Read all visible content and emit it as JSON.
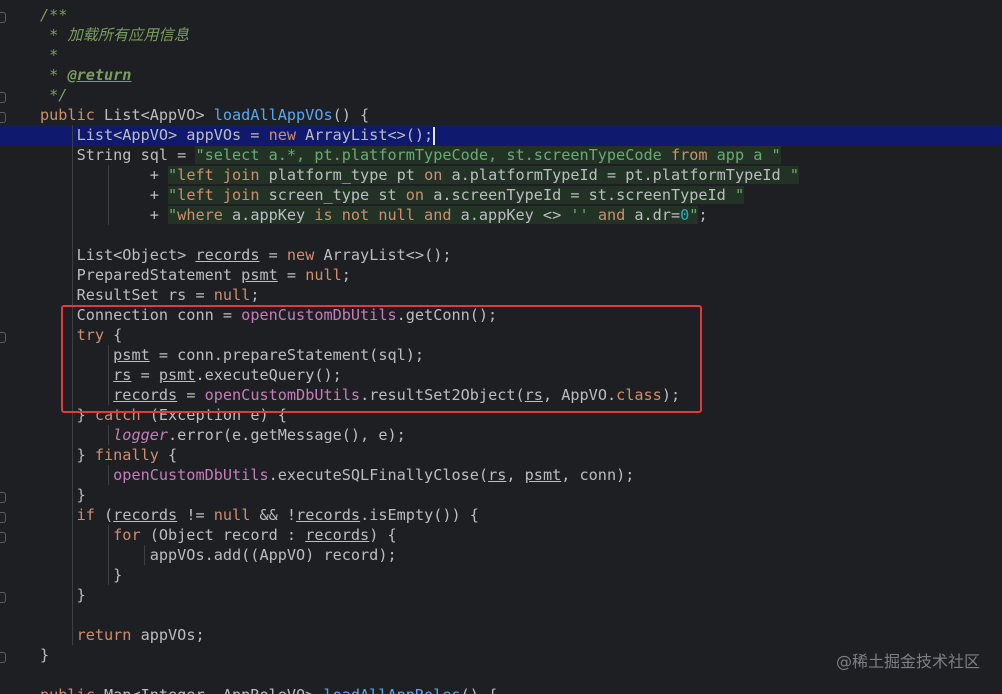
{
  "code_lines": [
    {
      "tokens": [
        {
          "t": "/**",
          "c": "cm"
        }
      ]
    },
    {
      "tokens": [
        {
          "t": " * 加载所有应用信息",
          "c": "cm"
        }
      ]
    },
    {
      "tokens": [
        {
          "t": " *",
          "c": "cm"
        }
      ]
    },
    {
      "tokens": [
        {
          "t": " * ",
          "c": "cm"
        },
        {
          "t": "@return",
          "c": "tag"
        }
      ]
    },
    {
      "tokens": [
        {
          "t": " */",
          "c": "cm"
        }
      ]
    },
    {
      "tokens": [
        {
          "t": "public ",
          "c": "kw"
        },
        {
          "t": "List<AppVO> ",
          "c": "plain"
        },
        {
          "t": "loadAllAppVOs",
          "c": "fn"
        },
        {
          "t": "() {",
          "c": "plain"
        }
      ]
    },
    {
      "current": true,
      "tokens": [
        {
          "t": "    List<AppVO> appVOs = ",
          "c": "plain"
        },
        {
          "t": "new ",
          "c": "kw"
        },
        {
          "t": "ArrayList<>();",
          "c": "plain"
        }
      ]
    },
    {
      "tokens": [
        {
          "t": "    String sql = ",
          "c": "plain"
        },
        {
          "t": "\"select a.*, pt.platformTypeCode, st.screenTypeCode ",
          "c": "str-bg"
        },
        {
          "t": "from",
          "c": "kw-bg"
        },
        {
          "t": " app a \"",
          "c": "str-bg"
        }
      ]
    },
    {
      "tokens": [
        {
          "t": "            + ",
          "c": "plain"
        },
        {
          "t": "\"",
          "c": "str-bg"
        },
        {
          "t": "left join",
          "c": "kw-bg"
        },
        {
          "t": " platform_type pt ",
          "c": "plain-bg"
        },
        {
          "t": "on",
          "c": "kw-bg"
        },
        {
          "t": " a.platformTypeId = pt.platformTypeId ",
          "c": "plain-bg"
        },
        {
          "t": "\"",
          "c": "str-bg"
        }
      ]
    },
    {
      "tokens": [
        {
          "t": "            + ",
          "c": "plain"
        },
        {
          "t": "\"",
          "c": "str-bg"
        },
        {
          "t": "left join",
          "c": "kw-bg"
        },
        {
          "t": " screen_type st ",
          "c": "plain-bg"
        },
        {
          "t": "on",
          "c": "kw-bg"
        },
        {
          "t": " a.screenTypeId = st.screenTypeId ",
          "c": "plain-bg"
        },
        {
          "t": "\"",
          "c": "str-bg"
        }
      ]
    },
    {
      "tokens": [
        {
          "t": "            + ",
          "c": "plain"
        },
        {
          "t": "\"",
          "c": "str-bg"
        },
        {
          "t": "where",
          "c": "kw-bg"
        },
        {
          "t": " a.appKey ",
          "c": "plain-bg"
        },
        {
          "t": "is not null and",
          "c": "kw-bg"
        },
        {
          "t": " a.appKey <> ",
          "c": "plain-bg"
        },
        {
          "t": "''",
          "c": "str-bg"
        },
        {
          "t": " ",
          "c": "plain-bg"
        },
        {
          "t": "and",
          "c": "kw-bg"
        },
        {
          "t": " a.dr=",
          "c": "plain-bg"
        },
        {
          "t": "0",
          "c": "num-bg"
        },
        {
          "t": "\"",
          "c": "str-bg"
        },
        {
          "t": ";",
          "c": "plain"
        }
      ]
    },
    {
      "tokens": []
    },
    {
      "tokens": [
        {
          "t": "    List<Object> ",
          "c": "plain"
        },
        {
          "t": "records",
          "c": "ul"
        },
        {
          "t": " = ",
          "c": "plain"
        },
        {
          "t": "new ",
          "c": "kw"
        },
        {
          "t": "ArrayList<>();",
          "c": "plain"
        }
      ]
    },
    {
      "tokens": [
        {
          "t": "    PreparedStatement ",
          "c": "plain"
        },
        {
          "t": "psmt",
          "c": "ul"
        },
        {
          "t": " = ",
          "c": "plain"
        },
        {
          "t": "null",
          "c": "kw"
        },
        {
          "t": ";",
          "c": "plain"
        }
      ]
    },
    {
      "tokens": [
        {
          "t": "    ResultSet rs = ",
          "c": "plain"
        },
        {
          "t": "null",
          "c": "kw"
        },
        {
          "t": ";",
          "c": "plain"
        }
      ]
    },
    {
      "tokens": [
        {
          "t": "    Connection conn = ",
          "c": "plain"
        },
        {
          "t": "openCustomDbUtils",
          "c": "field"
        },
        {
          "t": ".getConn();",
          "c": "plain"
        }
      ]
    },
    {
      "tokens": [
        {
          "t": "    ",
          "c": "plain"
        },
        {
          "t": "try",
          "c": "kw"
        },
        {
          "t": " {",
          "c": "plain"
        }
      ]
    },
    {
      "tokens": [
        {
          "t": "        ",
          "c": "plain"
        },
        {
          "t": "psmt",
          "c": "ul"
        },
        {
          "t": " = conn.prepareStatement(sql);",
          "c": "plain"
        }
      ]
    },
    {
      "tokens": [
        {
          "t": "        ",
          "c": "plain"
        },
        {
          "t": "rs",
          "c": "ul"
        },
        {
          "t": " = ",
          "c": "plain"
        },
        {
          "t": "psmt",
          "c": "ul"
        },
        {
          "t": ".executeQuery();",
          "c": "plain"
        }
      ]
    },
    {
      "tokens": [
        {
          "t": "        ",
          "c": "plain"
        },
        {
          "t": "records",
          "c": "ul"
        },
        {
          "t": " = ",
          "c": "plain"
        },
        {
          "t": "openCustomDbUtils",
          "c": "field"
        },
        {
          "t": ".resultSet2Object(",
          "c": "plain"
        },
        {
          "t": "rs",
          "c": "ul"
        },
        {
          "t": ", AppVO.",
          "c": "plain"
        },
        {
          "t": "class",
          "c": "kw"
        },
        {
          "t": ");",
          "c": "plain"
        }
      ]
    },
    {
      "tokens": [
        {
          "t": "    } ",
          "c": "plain"
        },
        {
          "t": "catch",
          "c": "kw"
        },
        {
          "t": " (Exception e) {",
          "c": "plain"
        }
      ]
    },
    {
      "tokens": [
        {
          "t": "        ",
          "c": "plain"
        },
        {
          "t": "logger",
          "c": "ital-field"
        },
        {
          "t": ".error(e.getMessage(), e);",
          "c": "plain"
        }
      ]
    },
    {
      "tokens": [
        {
          "t": "    } ",
          "c": "plain"
        },
        {
          "t": "finally",
          "c": "kw"
        },
        {
          "t": " {",
          "c": "plain"
        }
      ]
    },
    {
      "tokens": [
        {
          "t": "        ",
          "c": "plain"
        },
        {
          "t": "openCustomDbUtils",
          "c": "field"
        },
        {
          "t": ".executeSQLFinallyClose(",
          "c": "plain"
        },
        {
          "t": "rs",
          "c": "ul"
        },
        {
          "t": ", ",
          "c": "plain"
        },
        {
          "t": "psmt",
          "c": "ul"
        },
        {
          "t": ", conn);",
          "c": "plain"
        }
      ]
    },
    {
      "tokens": [
        {
          "t": "    }",
          "c": "plain"
        }
      ]
    },
    {
      "tokens": [
        {
          "t": "    ",
          "c": "plain"
        },
        {
          "t": "if",
          "c": "kw"
        },
        {
          "t": " (",
          "c": "plain"
        },
        {
          "t": "records",
          "c": "ul"
        },
        {
          "t": " != ",
          "c": "plain"
        },
        {
          "t": "null",
          "c": "kw"
        },
        {
          "t": " && !",
          "c": "plain"
        },
        {
          "t": "records",
          "c": "ul"
        },
        {
          "t": ".isEmpty()) {",
          "c": "plain"
        }
      ]
    },
    {
      "tokens": [
        {
          "t": "        ",
          "c": "plain"
        },
        {
          "t": "for",
          "c": "kw"
        },
        {
          "t": " (Object record : ",
          "c": "plain"
        },
        {
          "t": "records",
          "c": "ul"
        },
        {
          "t": ") {",
          "c": "plain"
        }
      ]
    },
    {
      "tokens": [
        {
          "t": "            appVOs.add((AppVO) record);",
          "c": "plain"
        }
      ]
    },
    {
      "tokens": [
        {
          "t": "        }",
          "c": "plain"
        }
      ]
    },
    {
      "tokens": [
        {
          "t": "    }",
          "c": "plain"
        }
      ]
    },
    {
      "tokens": []
    },
    {
      "tokens": [
        {
          "t": "    ",
          "c": "plain"
        },
        {
          "t": "return",
          "c": "kw"
        },
        {
          "t": " appVOs;",
          "c": "plain"
        }
      ]
    },
    {
      "tokens": [
        {
          "t": "}",
          "c": "plain"
        }
      ]
    },
    {
      "tokens": []
    },
    {
      "tokens": [
        {
          "t": "public ",
          "c": "kw"
        },
        {
          "t": "Map<Integer, AppRoleVO> ",
          "c": "plain"
        },
        {
          "t": "loadAllAppRoles",
          "c": "fn"
        },
        {
          "t": "() {",
          "c": "plain"
        }
      ]
    }
  ],
  "colors": {
    "background": "#1e1f22",
    "current_line": "#0f1a6e",
    "highlight_box": "#e03a3a"
  },
  "watermark": "@稀土掘金技术社区"
}
